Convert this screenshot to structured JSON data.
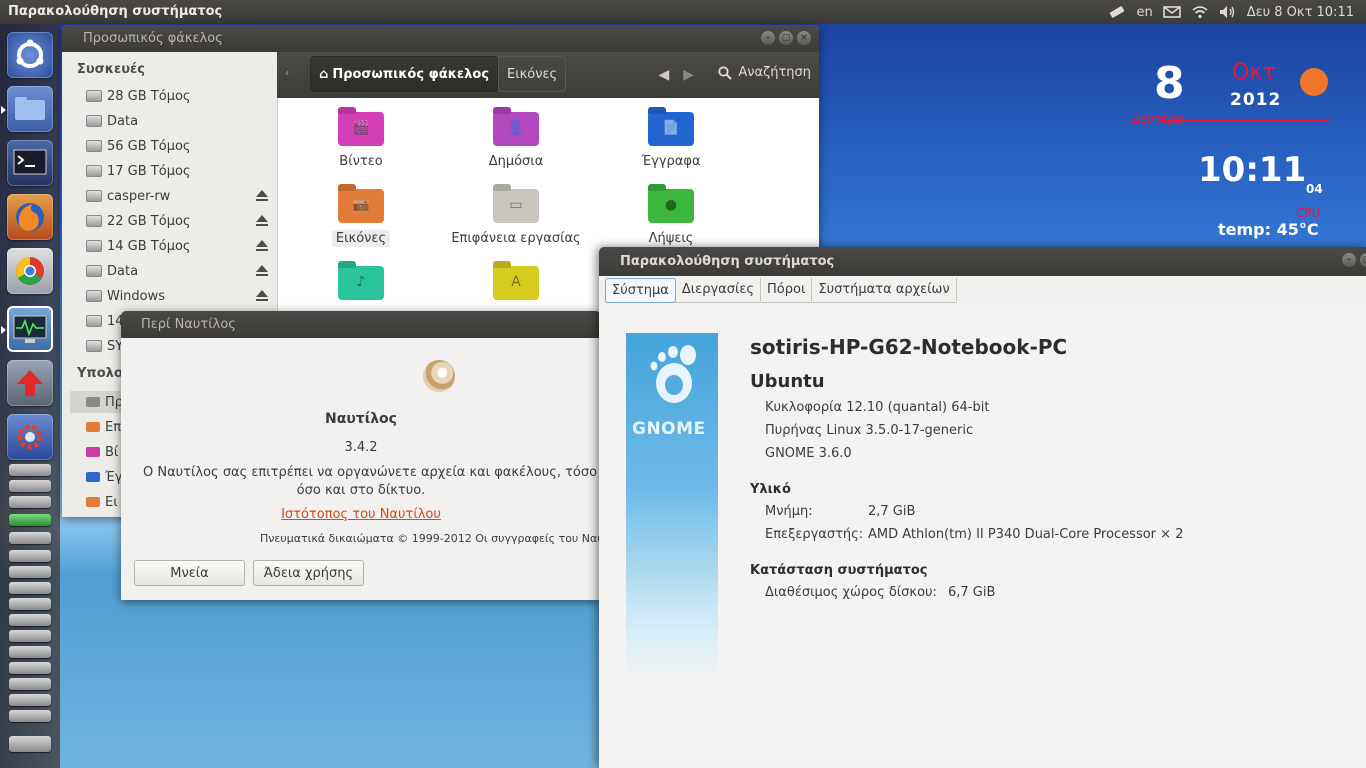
{
  "top_panel": {
    "app_title": "Παρακολούθηση συστήματος",
    "keyboard_layout": "en",
    "clock": "Δευ  8 Οκτ  10:11",
    "icons": [
      "usb-stick-icon",
      "mail-icon",
      "wifi-icon",
      "volume-icon"
    ]
  },
  "launcher": {
    "items": [
      "ubuntu-dash",
      "files",
      "terminal",
      "firefox",
      "chrome",
      "system-monitor",
      "update-manager",
      "settings"
    ]
  },
  "widget": {
    "day": "8",
    "month": "Οκτ",
    "year": "2012",
    "weekday": "Δευτέρα",
    "time": "10:11",
    "seconds": "04",
    "cpu_label": "CPU",
    "temp": "temp: 45°C"
  },
  "nautilus": {
    "title": "Προσωπικός φάκελος",
    "sidebar": {
      "devices_head": "Συσκευές",
      "devices": [
        {
          "label": "28 GB Τόμος",
          "eject": false
        },
        {
          "label": "Data",
          "eject": false
        },
        {
          "label": "56 GB Τόμος",
          "eject": false
        },
        {
          "label": "17 GB Τόμος",
          "eject": false
        },
        {
          "label": "casper-rw",
          "eject": true
        },
        {
          "label": "22 GB Τόμος",
          "eject": true
        },
        {
          "label": "14 GB Τόμος",
          "eject": true
        },
        {
          "label": "Data",
          "eject": true
        },
        {
          "label": "Windows",
          "eject": true
        },
        {
          "label": "14",
          "eject": false
        },
        {
          "label": "SY",
          "eject": false
        }
      ],
      "computer_head": "Υπολο",
      "places": [
        {
          "label": "Πρ",
          "color": "#888888"
        },
        {
          "label": "Επ",
          "color": "#e37b3a"
        },
        {
          "label": "Βί",
          "color": "#c83ca8"
        },
        {
          "label": "Έγ",
          "color": "#2a68d0"
        },
        {
          "label": "Ει",
          "color": "#e37b3a"
        }
      ]
    },
    "breadcrumb": {
      "home": "Προσωπικός φάκελος",
      "current": "Εικόνες"
    },
    "search_label": "Αναζήτηση",
    "folders": [
      {
        "label": "Βίντεο",
        "color": "#d23fb7",
        "glyph": "🎬"
      },
      {
        "label": "Δημόσια",
        "color": "#b247c0",
        "glyph": "👤"
      },
      {
        "label": "Έγγραφα",
        "color": "#2466d1",
        "glyph": "📄"
      },
      {
        "label": "Εικόνες",
        "color": "#e37b3a",
        "glyph": "📷"
      },
      {
        "label": "Επιφάνεια εργασίας",
        "color": "#c9c5bf",
        "glyph": "▭"
      },
      {
        "label": "Λήψεις",
        "color": "#3bb83b",
        "glyph": "●"
      },
      {
        "label": "",
        "color": "#2cc49a",
        "glyph": "♪"
      },
      {
        "label": "",
        "color": "#d8cc22",
        "glyph": "A"
      }
    ]
  },
  "about": {
    "title": "Περί Ναυτίλος",
    "app_name": "Ναυτίλος",
    "version": "3.4.2",
    "description_1": "Ο Ναυτίλος σας επιτρέπει να οργανώνετε αρχεία και φακέλους, τόσο",
    "description_2": "όσο και στο δίκτυο.",
    "website": "Ιστότοπος του Ναυτίλου",
    "copyright": "Πνευματικά δικαιώματα © 1999-2012 Οι συγγραφείς του Ναυτ",
    "credits_button": "Μνεία",
    "license_button": "Άδεια χρήσης"
  },
  "sysmon": {
    "title": "Παρακολούθηση συστήματος",
    "tabs": [
      "Σύστημα",
      "Διεργασίες",
      "Πόροι",
      "Συστήματα αρχείων"
    ],
    "active_tab": 0,
    "banner_text": "GNOME",
    "hostname": "sotiris-HP-G62-Notebook-PC",
    "os_name": "Ubuntu",
    "release": "Κυκλοφορία 12.10 (quantal) 64-bit",
    "kernel": "Πυρήνας Linux 3.5.0-17-generic",
    "gnome": "GNOME 3.6.0",
    "hardware_head": "Υλικό",
    "memory_label": "Μνήμη:",
    "memory_value": "2,7 GiB",
    "cpu_label": "Επεξεργαστής:",
    "cpu_value": "AMD Athlon(tm) II P340 Dual-Core Processor × 2",
    "status_head": "Κατάσταση συστήματος",
    "disk_label": "Διαθέσιμος χώρος δίσκου:",
    "disk_value": "6,7 GiB"
  }
}
